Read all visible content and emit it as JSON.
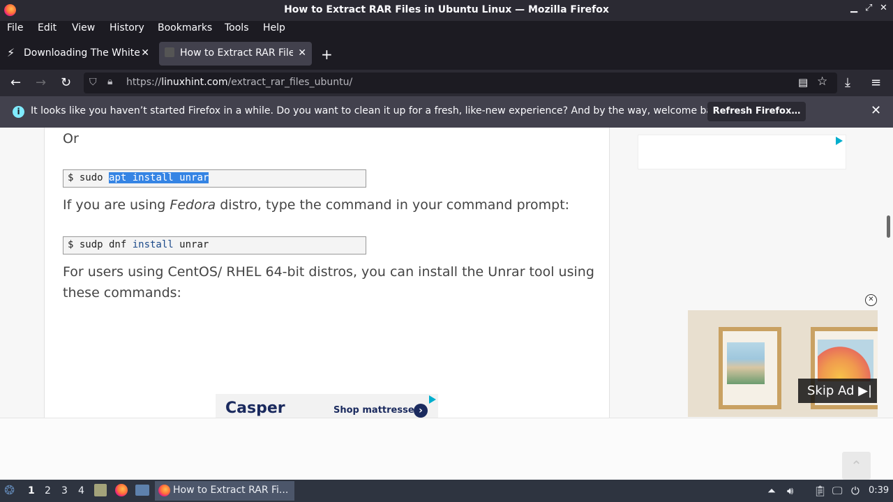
{
  "window": {
    "title": "How to Extract RAR Files in Ubuntu Linux — Mozilla Firefox"
  },
  "menu": [
    "File",
    "Edit",
    "View",
    "History",
    "Bookmarks",
    "Tools",
    "Help"
  ],
  "tabs": [
    {
      "label": "Downloading The White Hat",
      "active": false
    },
    {
      "label": "How to Extract RAR Files in Ubuntu",
      "active": true
    }
  ],
  "url": {
    "prefix": "https://",
    "domain": "linuxhint.com",
    "path": "/extract_rar_files_ubuntu/"
  },
  "infobar": {
    "message": "It looks like you haven’t started Firefox in a while. Do you want to clean it up for a fresh, like-new experience? And by the way, welcome back!",
    "button": "Refresh Firefox…"
  },
  "article": {
    "or": "Or",
    "code1": {
      "prompt": "$ sudo ",
      "selected": "apt install unrar"
    },
    "fedora_pre": "If you are using ",
    "fedora_em": "Fedora",
    "fedora_post": " distro, type the command in your command prompt:",
    "code2": {
      "prompt": "$ sudp dnf ",
      "kw": "install",
      "rest": " unrar"
    },
    "centos_line1": "For users using CentOS/ RHEL 64-bit distros, you can install the Unrar tool using",
    "centos_line2": "these commands:"
  },
  "ads": {
    "casper_logo": "Casper",
    "casper_cta": "Shop mattresses",
    "skip": "Skip Ad"
  },
  "taskbar": {
    "workspaces": [
      "1",
      "2",
      "3",
      "4"
    ],
    "active_task": "How to Extract RAR Fi...",
    "clock": "0:39"
  }
}
